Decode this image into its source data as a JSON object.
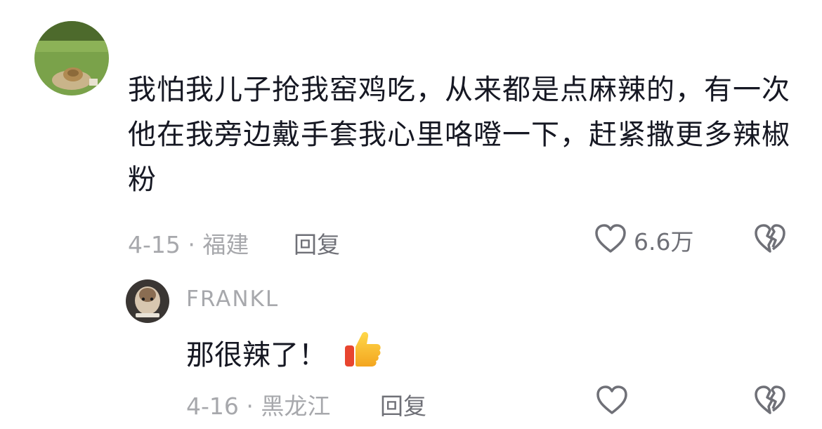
{
  "comment": {
    "text": "我怕我儿子抢我窑鸡吃，从来都是点麻辣的，有一次他在我旁边戴手套我心里咯噔一下，赶紧撒更多辣椒粉",
    "date_location": "4-15 · 福建",
    "reply_label": "回复",
    "like_count": "6.6万",
    "avatar_icon": "grass-field-avatar",
    "like_icon": "heart-outline-icon",
    "dislike_icon": "broken-heart-icon"
  },
  "reply": {
    "username": "FRANKL",
    "text": "那很辣了！",
    "emoji": "thumbs-up-emoji",
    "date_location": "4-16 · 黑龙江",
    "reply_label": "回复",
    "avatar_icon": "hamster-avatar",
    "like_icon": "heart-outline-icon",
    "dislike_icon": "broken-heart-icon"
  },
  "colors": {
    "text": "#161823",
    "meta": "#a7a8ac",
    "action": "#6f7077"
  }
}
